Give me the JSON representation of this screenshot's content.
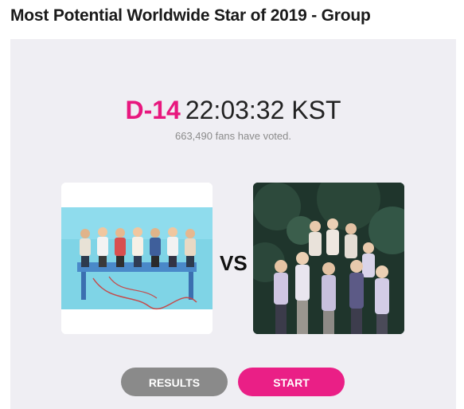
{
  "header": {
    "title": "Most Potential Worldwide Star of 2019 - Group"
  },
  "countdown": {
    "dday": "D-14",
    "time": "22:03:32 KST"
  },
  "votes": {
    "text": "663,490 fans have voted."
  },
  "matchup": {
    "vs_label": "VS",
    "left_icon": "group-photo-icon",
    "right_icon": "group-photo-icon"
  },
  "actions": {
    "results_label": "RESULTS",
    "start_label": "START"
  },
  "colors": {
    "accent": "#ea1f86",
    "dday": "#e8177e",
    "panel_bg": "#efeef3",
    "results_button": "#8a8a8a"
  }
}
